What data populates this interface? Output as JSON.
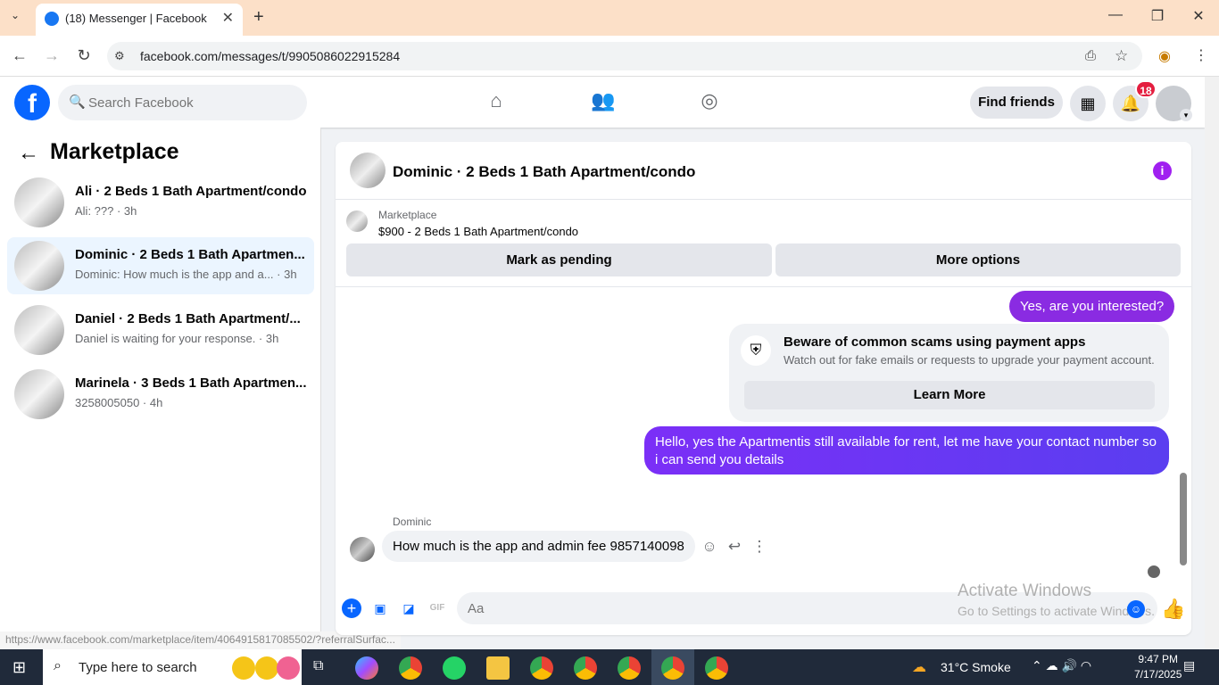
{
  "browser": {
    "tab_title": "(18) Messenger | Facebook",
    "url": "facebook.com/messages/t/9905086022915284",
    "status_url": "https://www.facebook.com/marketplace/item/4064915817085502/?referralSurfac..."
  },
  "header": {
    "search_placeholder": "Search Facebook",
    "find_friends": "Find friends",
    "notification_count": "18"
  },
  "sidebar": {
    "title": "Marketplace",
    "conversations": [
      {
        "name": "Ali · 2 Beds 1 Bath Apartment/condo",
        "preview": "Ali: ??? · 3h"
      },
      {
        "name": "Dominic · 2 Beds 1 Bath Apartmen...",
        "preview": "Dominic: How much is the app and a... · 3h"
      },
      {
        "name": "Daniel · 2 Beds 1 Bath Apartment/...",
        "preview": "Daniel is waiting for your response. · 3h"
      },
      {
        "name": "Marinela · 3 Beds 1 Bath Apartmen...",
        "preview": "3258005050 · 4h"
      }
    ]
  },
  "chat": {
    "title": "Dominic · 2 Beds 1 Bath Apartment/condo",
    "marketplace_label": "Marketplace",
    "listing": "$900 - 2 Beds 1 Bath Apartment/condo",
    "mark_pending": "Mark as pending",
    "more_options": "More options",
    "messages": {
      "out1": "Yes, are you interested?",
      "scam_title": "Beware of common scams using payment apps",
      "scam_sub": "Watch out for fake emails or requests to upgrade your payment account.",
      "learn_more": "Learn More",
      "out2": "Hello, yes the Apartmentis still available for rent, let me have your contact number so i can send you  details",
      "sender": "Dominic",
      "in1": "How much is the app and admin fee 9857140098"
    },
    "composer_placeholder": "Aa"
  },
  "watermark": {
    "line1": "Activate Windows",
    "line2": "Go to Settings to activate Windows."
  },
  "taskbar": {
    "search": "Type here to search",
    "weather": "31°C  Smoke",
    "time": "9:47 PM",
    "date": "7/17/2025"
  },
  "colors": {
    "accent": "#0866ff",
    "bubble_out": "#8a2be2",
    "badge": "#e41e3f"
  }
}
